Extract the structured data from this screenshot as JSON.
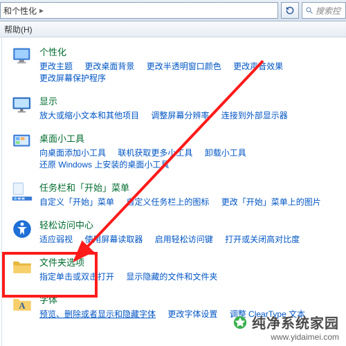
{
  "address": {
    "crumb": "和个性化",
    "sep": "▸"
  },
  "search": {
    "placeholder": "搜索控"
  },
  "menubar": {
    "help": "帮助(H)"
  },
  "categories": [
    {
      "title": "个性化",
      "links": [
        "更改主题",
        "更改桌面背景",
        "更改半透明窗口颜色",
        "更改声音效果",
        "更改屏幕保护程序"
      ]
    },
    {
      "title": "显示",
      "links": [
        "放大或缩小文本和其他项目",
        "调整屏幕分辨率",
        "连接到外部显示器"
      ]
    },
    {
      "title": "桌面小工具",
      "links": [
        "向桌面添加小工具",
        "联机获取更多小工具",
        "卸载小工具",
        "还原 Windows 上安装的桌面小工具"
      ]
    },
    {
      "title": "任务栏和「开始」菜单",
      "links": [
        "自定义「开始」菜单",
        "自定义任务栏上的图标",
        "更改「开始」菜单上的图片"
      ]
    },
    {
      "title": "轻松访问中心",
      "links": [
        "适应弱视",
        "使用屏幕读取器",
        "启用轻松访问键",
        "打开或关闭高对比度"
      ]
    },
    {
      "title": "文件夹选项",
      "links": [
        "指定单击或双击打开",
        "显示隐藏的文件和文件夹"
      ]
    },
    {
      "title": "字体",
      "links": [
        "预览、删除或者显示和隐藏字体",
        "更改字体设置",
        "调整 ClearType 文本"
      ]
    }
  ],
  "watermark": {
    "brand": "纯净系统家园",
    "url": "www.yidaimei.com"
  }
}
